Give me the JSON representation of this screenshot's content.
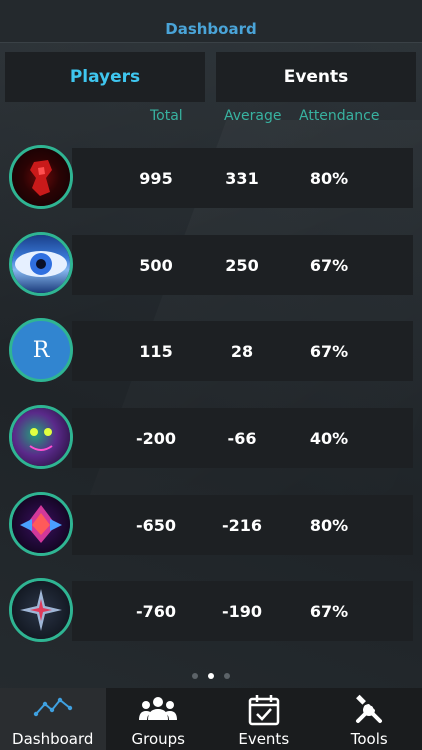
{
  "header": {
    "title": "Dashboard"
  },
  "segments": {
    "players": "Players",
    "events": "Events"
  },
  "columns": {
    "total": "Total",
    "average": "Average",
    "attendance": "Attendance"
  },
  "rows": [
    {
      "total": "995",
      "average": "331",
      "attendance": "80%",
      "avatar": "red-robot-avatar"
    },
    {
      "total": "500",
      "average": "250",
      "attendance": "67%",
      "avatar": "blue-eye-avatar"
    },
    {
      "total": "115",
      "average": "28",
      "attendance": "67%",
      "avatar": "initial-avatar",
      "initial": "R"
    },
    {
      "total": "-200",
      "average": "-66",
      "attendance": "40%",
      "avatar": "neon-face-avatar"
    },
    {
      "total": "-650",
      "average": "-216",
      "attendance": "80%",
      "avatar": "crystal-emblem-avatar"
    },
    {
      "total": "-760",
      "average": "-190",
      "attendance": "67%",
      "avatar": "star-emblem-avatar"
    }
  ],
  "pager": {
    "count": 3,
    "active": 1
  },
  "tabs": [
    {
      "label": "Dashboard",
      "icon": "chart-line-icon"
    },
    {
      "label": "Groups",
      "icon": "group-icon"
    },
    {
      "label": "Events",
      "icon": "calendar-check-icon"
    },
    {
      "label": "Tools",
      "icon": "tools-icon"
    }
  ],
  "colors": {
    "accent": "#3fc6ef",
    "teal": "#38b2a0",
    "ring": "#2fb593",
    "title": "#4aa4d8"
  }
}
